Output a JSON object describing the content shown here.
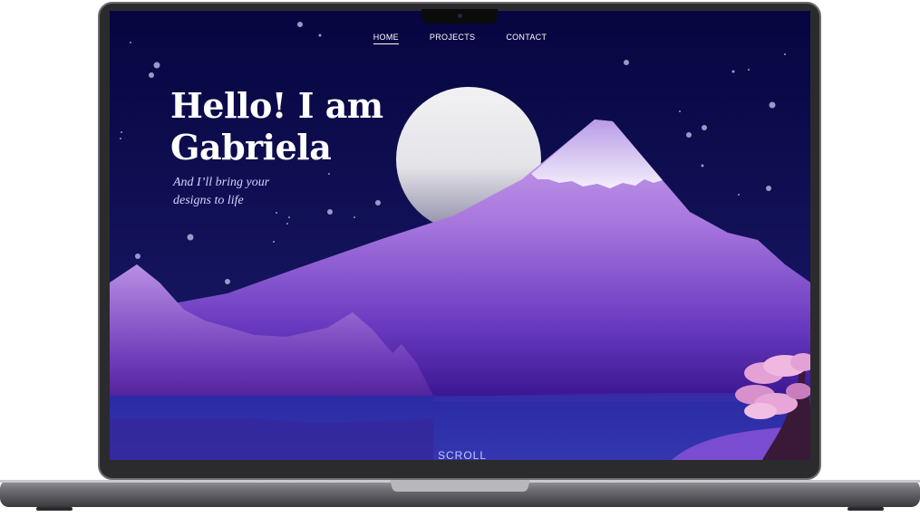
{
  "nav": {
    "items": [
      {
        "label": "HOME",
        "active": true
      },
      {
        "label": "PROJECTS",
        "active": false
      },
      {
        "label": "CONTACT",
        "active": false
      }
    ]
  },
  "hero": {
    "title_line1": "Hello! I am",
    "title_line2": "Gabriela",
    "subtitle_line1": "And I’ll bring your",
    "subtitle_line2": "designs to life"
  },
  "scroll_label": "SCROLL",
  "colors": {
    "sky_top": "#090747",
    "sky_bottom": "#1c1d6e",
    "mountain_light": "#c09ae6",
    "mountain_dark": "#3b0e8a",
    "lake": "#2b2ea3",
    "blossom": "#e8a0d8",
    "laptop_frame": "#2b2b2e"
  },
  "icons": [
    "webcam-icon"
  ]
}
